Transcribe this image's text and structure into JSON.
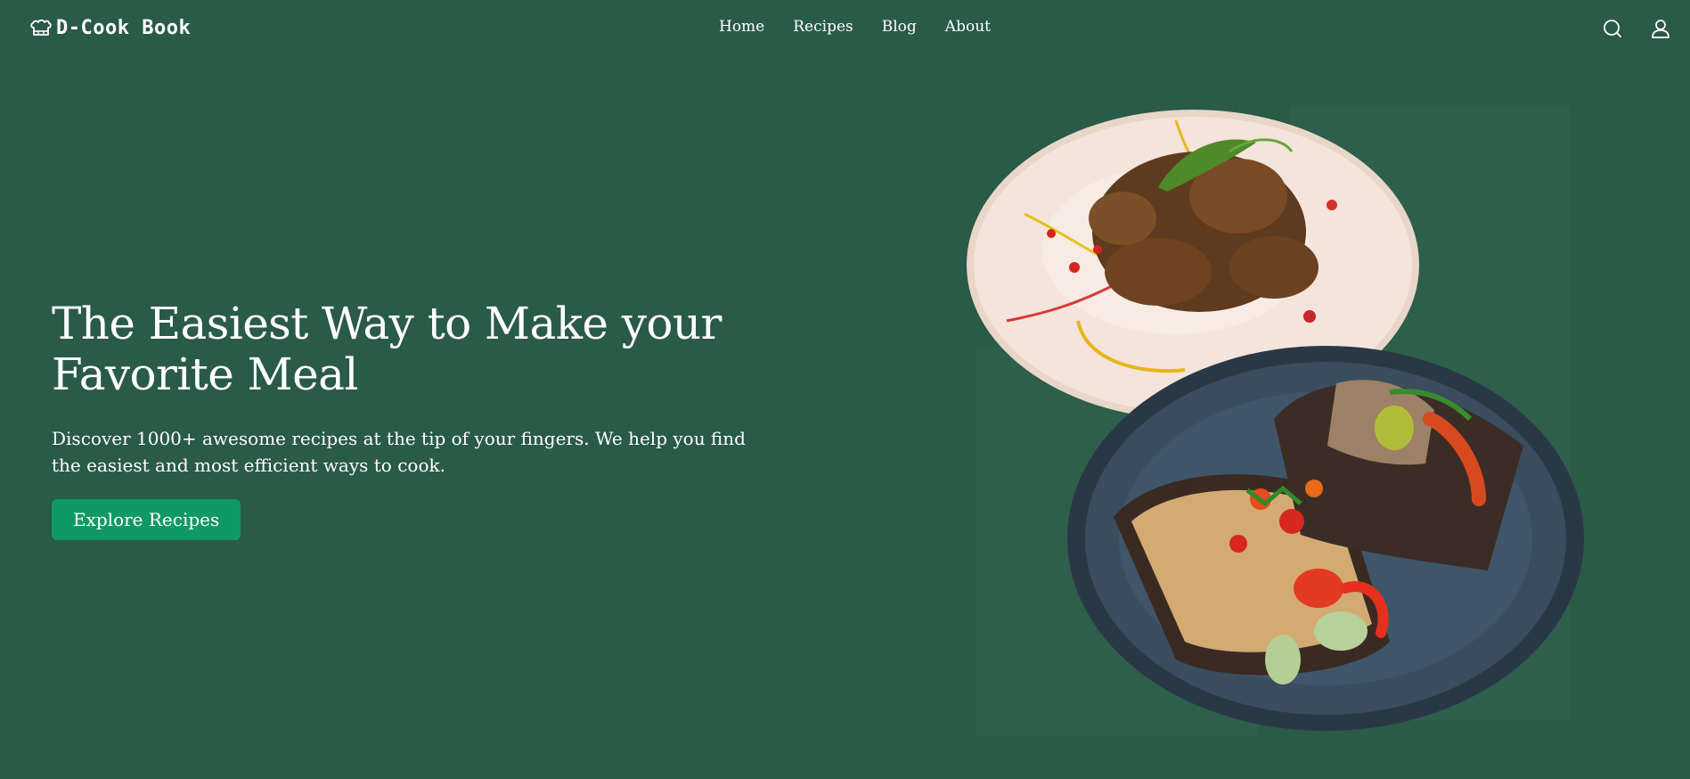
{
  "header": {
    "brand": "D-Cook Book",
    "nav": [
      {
        "label": "Home"
      },
      {
        "label": "Recipes"
      },
      {
        "label": "Blog"
      },
      {
        "label": "About"
      }
    ],
    "icons": [
      "search-icon",
      "user-icon"
    ]
  },
  "hero": {
    "title_line1": "The Easiest Way to Make your",
    "title_line2": "Favorite Meal",
    "description": "Discover 1000+ awesome recipes at the tip of your fingers. We help you find the easiest and most efficient ways to cook.",
    "cta_label": "Explore Recipes"
  },
  "colors": {
    "background": "#2a5a48",
    "panel": "#2e5e4c",
    "cta": "#0f9a63",
    "text": "#ffffff"
  }
}
